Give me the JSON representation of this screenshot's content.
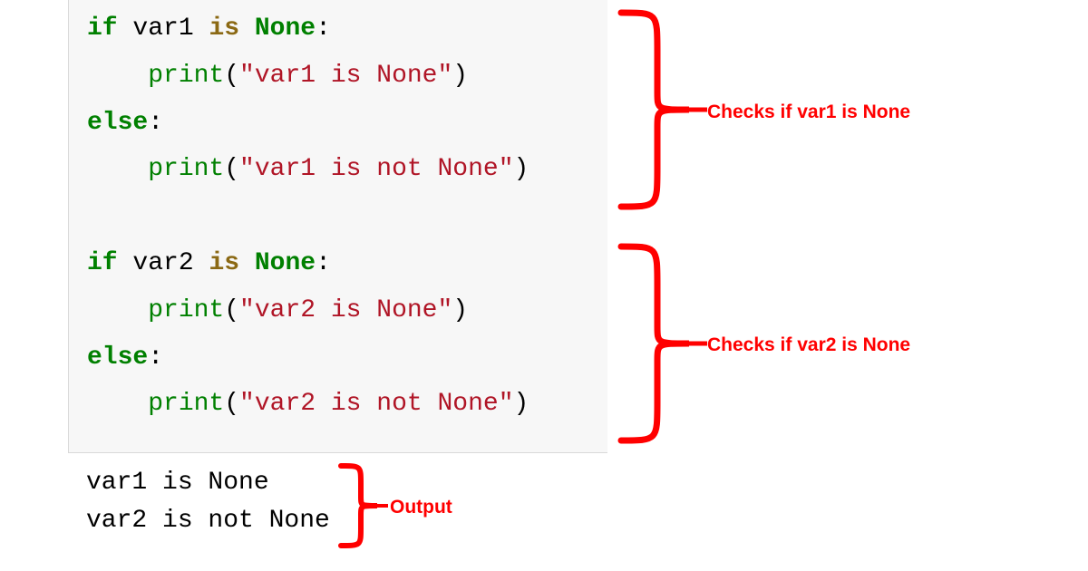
{
  "code": {
    "block1": {
      "if_kw": "if",
      "var": " var1 ",
      "is_kw": "is",
      "sp": " ",
      "none_kw": "None",
      "colon": ":",
      "indent": "    ",
      "print": "print",
      "lpar": "(",
      "str_true": "\"var1 is None\"",
      "rpar": ")",
      "else_kw": "else",
      "str_false": "\"var1 is not None\""
    },
    "block2": {
      "if_kw": "if",
      "var": " var2 ",
      "is_kw": "is",
      "sp": " ",
      "none_kw": "None",
      "colon": ":",
      "indent": "    ",
      "print": "print",
      "lpar": "(",
      "str_true": "\"var2 is None\"",
      "rpar": ")",
      "else_kw": "else",
      "str_false": "\"var2 is not None\""
    }
  },
  "output": {
    "line1": "var1 is None",
    "line2": "var2 is not None"
  },
  "annotations": {
    "block1": "Checks if var1 is None",
    "block2": "Checks if var2 is None",
    "output": "Output"
  },
  "colors": {
    "keyword": "#008000",
    "string": "#b01526",
    "annotation": "#ff0000",
    "bg_code": "#f7f7f7"
  }
}
